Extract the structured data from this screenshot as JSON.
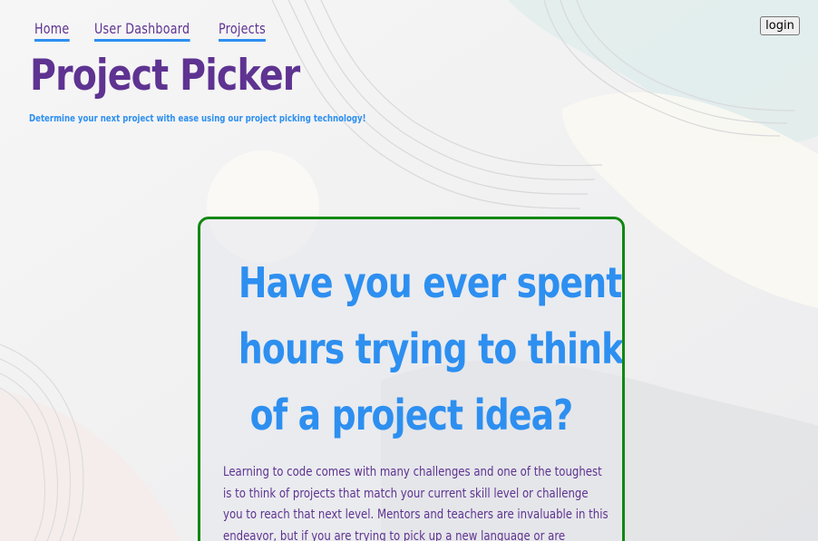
{
  "nav": {
    "items": [
      {
        "label": "Home"
      },
      {
        "label": "User Dashboard"
      },
      {
        "label": "Projects"
      }
    ]
  },
  "auth": {
    "login_label": "login"
  },
  "brand": {
    "title": "Project Picker",
    "tagline": "Determine your next project with ease using our project picking technology!"
  },
  "hero": {
    "heading_lines": [
      "Have you ever spent",
      "hours trying to think",
      "of a project idea?"
    ],
    "body_lines": [
      "Learning to code comes with many challenges and one of the toughest",
      "is to think of projects that match your current skill level or challenge",
      "you to reach that next level. Mentors and teachers are invaluable in this",
      "endeavor, but if you are trying to pick up a new language or are"
    ]
  },
  "colors": {
    "purple": "#5e3391",
    "blue": "#2d8ff0",
    "green_border": "#118811"
  }
}
